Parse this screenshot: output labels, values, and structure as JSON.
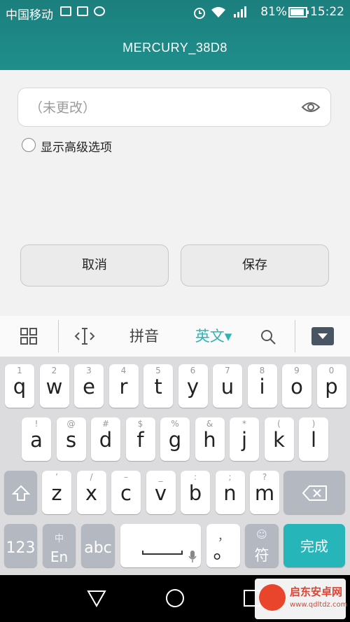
{
  "status": {
    "carrier": "中国移动",
    "battery": "81%",
    "time": "15:22"
  },
  "title": "MERCURY_38D8",
  "password": {
    "placeholder": "（未更改）",
    "value": ""
  },
  "advanced": {
    "label": "显示高级选项"
  },
  "buttons": {
    "cancel": "取消",
    "save": "保存"
  },
  "keyboard": {
    "toolbar": {
      "pinyin": "拼音",
      "english": "英文▾"
    },
    "row1": [
      {
        "m": "q",
        "s": "1"
      },
      {
        "m": "w",
        "s": "2"
      },
      {
        "m": "e",
        "s": "3"
      },
      {
        "m": "r",
        "s": "4"
      },
      {
        "m": "t",
        "s": "5"
      },
      {
        "m": "y",
        "s": "6"
      },
      {
        "m": "u",
        "s": "7"
      },
      {
        "m": "i",
        "s": "8"
      },
      {
        "m": "o",
        "s": "9"
      },
      {
        "m": "p",
        "s": "0"
      }
    ],
    "row2": [
      {
        "m": "a",
        "s": "!"
      },
      {
        "m": "s",
        "s": "@"
      },
      {
        "m": "d",
        "s": "#"
      },
      {
        "m": "f",
        "s": "$"
      },
      {
        "m": "g",
        "s": "%"
      },
      {
        "m": "h",
        "s": "&"
      },
      {
        "m": "j",
        "s": "*"
      },
      {
        "m": "k",
        "s": "("
      },
      {
        "m": "l",
        "s": ")"
      }
    ],
    "row3": [
      {
        "m": "z",
        "s": "’"
      },
      {
        "m": "x",
        "s": "/"
      },
      {
        "m": "c",
        "s": "–"
      },
      {
        "m": "v",
        "s": "_"
      },
      {
        "m": "b",
        "s": ":"
      },
      {
        "m": "n",
        "s": ";"
      },
      {
        "m": "m",
        "s": "?"
      }
    ],
    "bottom": {
      "num": "123",
      "lang_top": "中",
      "lang": "En",
      "abc": "abc",
      "comma": "，",
      "dot": "。",
      "sym_top": "☺",
      "sym": "符",
      "done": "完成"
    }
  },
  "watermark": {
    "name": "启东安卓网",
    "url": "www.qdltdz.com"
  }
}
